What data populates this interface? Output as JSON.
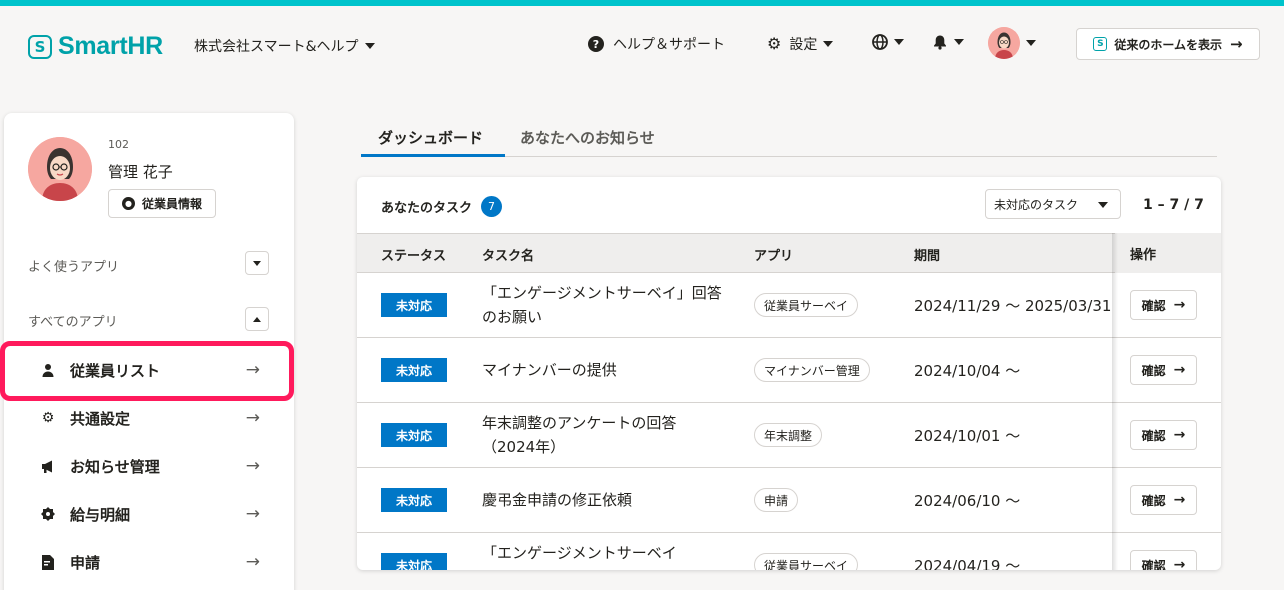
{
  "header": {
    "brand": "SmartHR",
    "brand_mark": "S",
    "tenant": "株式会社スマート&ヘルプ",
    "help": "ヘルプ＆サポート",
    "settings": "設定",
    "legacy_home": "従来のホームを表示",
    "icons": [
      "help-icon",
      "gear-icon",
      "globe-icon",
      "bell-icon",
      "avatar",
      "arrow-right-icon"
    ]
  },
  "profile": {
    "employee_no": "102",
    "name": "管理 花子",
    "info_button": "従業員情報"
  },
  "sidebar": {
    "frequent_title": "よく使うアプリ",
    "all_title": "すべてのアプリ",
    "items": [
      {
        "label": "従業員リスト",
        "icon": "person-icon"
      },
      {
        "label": "共通設定",
        "icon": "gear-icon"
      },
      {
        "label": "お知らせ管理",
        "icon": "megaphone-icon"
      },
      {
        "label": "給与明細",
        "icon": "badge-icon"
      },
      {
        "label": "申請",
        "icon": "document-icon"
      }
    ]
  },
  "tabs": {
    "active": "ダッシュボード",
    "inactive": "あなたへのお知らせ"
  },
  "tasks": {
    "title": "あなたのタスク",
    "count": "7",
    "filter": "未対応のタスク",
    "pager": "1 – 7 / 7",
    "columns": {
      "status": "ステータス",
      "name": "タスク名",
      "app": "アプリ",
      "period": "期間",
      "action": "操作"
    },
    "rows": [
      {
        "status": "未対応",
        "name": "「エンゲージメントサーベイ」回答のお願い",
        "app": "従業員サーベイ",
        "period": "2024/11/29 〜 2025/03/31",
        "action": "確認"
      },
      {
        "status": "未対応",
        "name": "マイナンバーの提供",
        "app": "マイナンバー管理",
        "period": "2024/10/04 〜",
        "action": "確認"
      },
      {
        "status": "未対応",
        "name": "年末調整のアンケートの回答（2024年）",
        "app": "年末調整",
        "period": "2024/10/01 〜",
        "action": "確認"
      },
      {
        "status": "未対応",
        "name": "慶弔金申請の修正依頼",
        "app": "申請",
        "period": "2024/06/10 〜",
        "action": "確認"
      },
      {
        "status": "未対応",
        "name": "「エンゲージメントサーベイ",
        "app": "従業員サーベイ",
        "period": "2024/04/19 〜",
        "action": "確認"
      }
    ]
  },
  "colors": {
    "accent_teal": "#00c4cc",
    "brand": "#00a2a9",
    "primary_blue": "#0077c7",
    "highlight": "#ff1a5c"
  }
}
